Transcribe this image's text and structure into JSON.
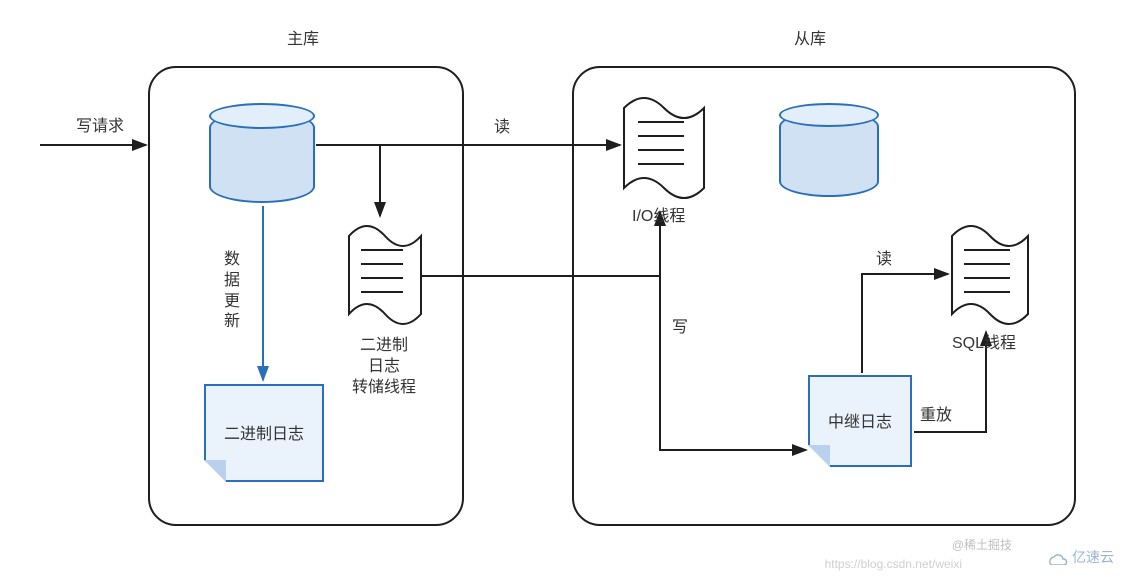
{
  "titles": {
    "master": "主库",
    "slave": "从库"
  },
  "labels": {
    "write_request": "写请求",
    "data_update": "数\n据\n更\n新",
    "read1": "读",
    "binlog_dump_thread": "二进制\n日志\n转储线程",
    "io_thread": "I/O线程",
    "write": "写",
    "read2": "读",
    "sql_thread": "SQL线程",
    "replay": "重放",
    "binlog": "二进制日志",
    "relaylog": "中继日志"
  },
  "watermarks": {
    "csdn": "https://blog.csdn.net/weixi",
    "juejin": "@稀土掘技",
    "yisu": "亿速云"
  }
}
